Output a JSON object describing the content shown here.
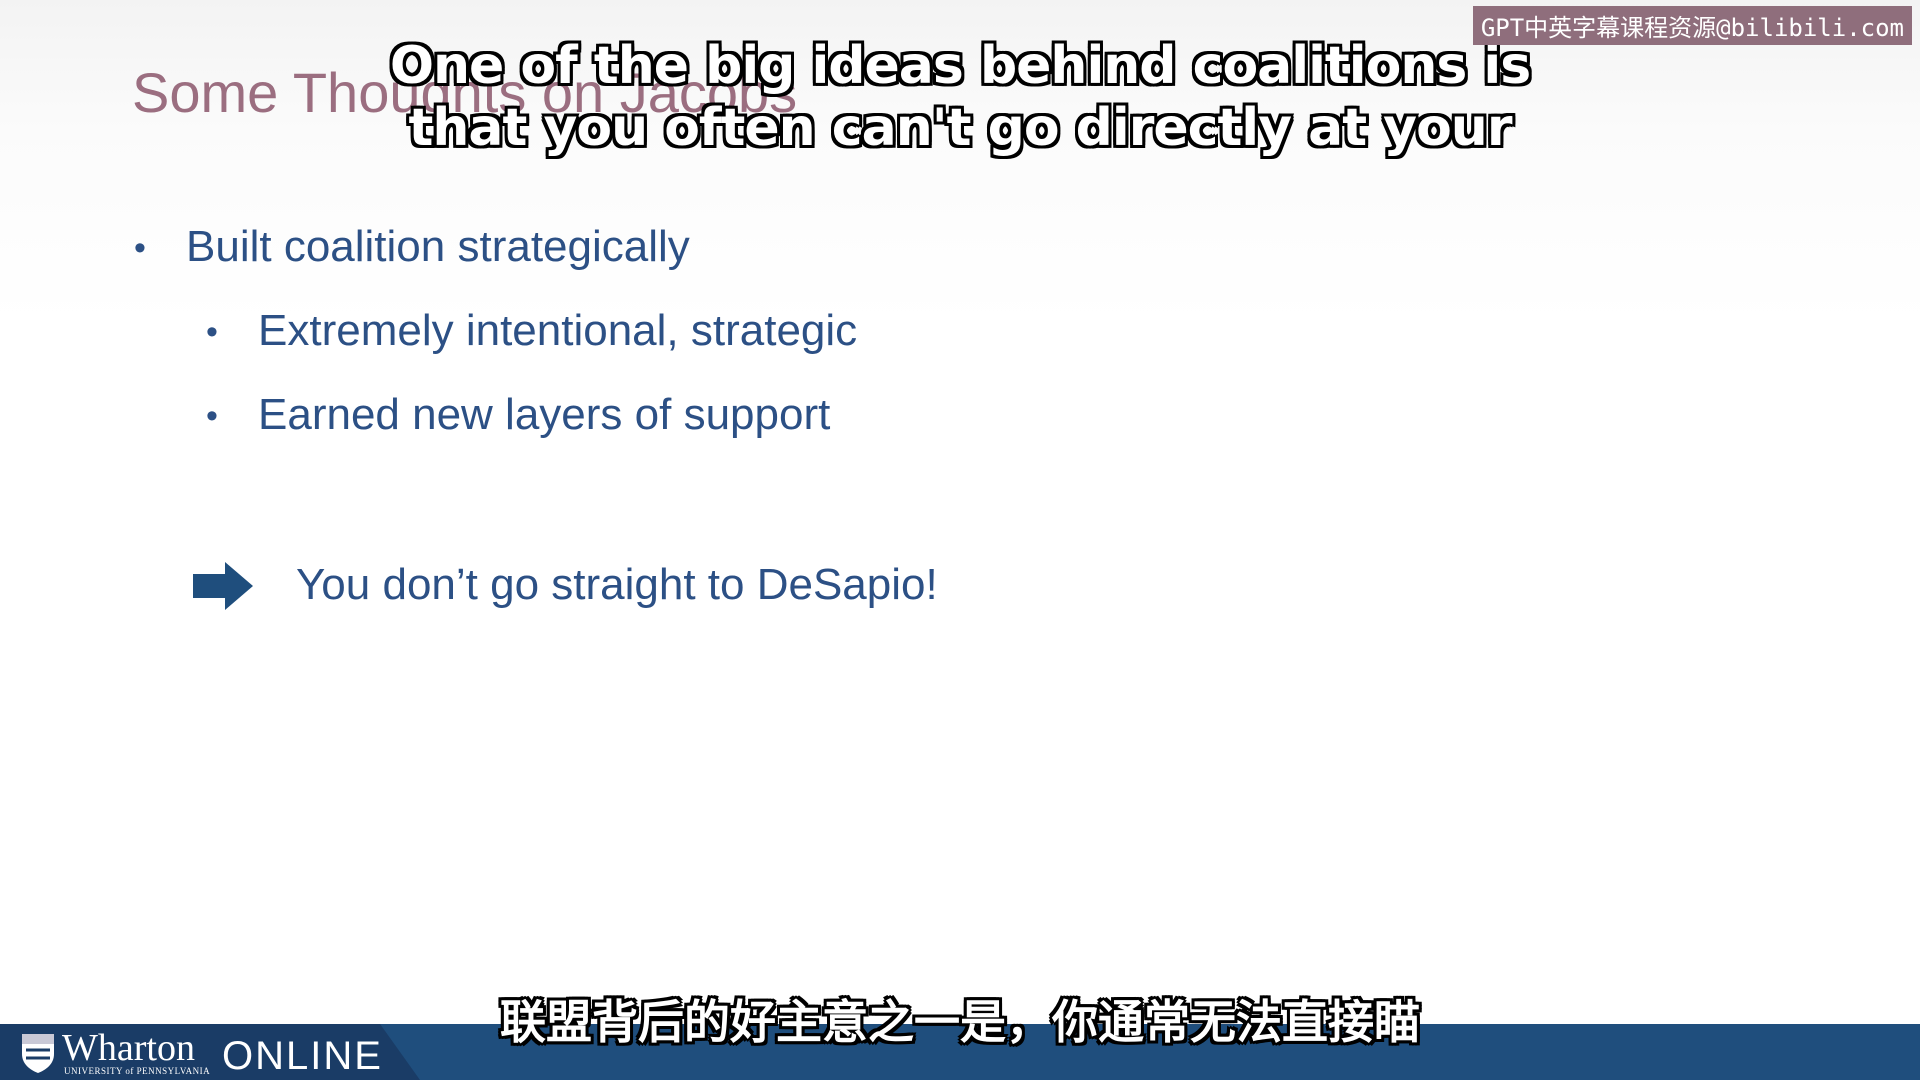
{
  "slide": {
    "title": "Some Thoughts on Jacobs",
    "bullets": [
      {
        "text": "Built coalition strategically",
        "level": 1
      },
      {
        "text": "Extremely intentional, strategic",
        "level": 2
      },
      {
        "text": "Earned new layers of support",
        "level": 2
      }
    ],
    "conclusion": "You don’t go straight to DeSapio!",
    "bullet_char": "•"
  },
  "subtitles": {
    "en_line1": "One of the big ideas behind coalitions is",
    "en_line2": "that you often can't go directly at your",
    "cn": "联盟背后的好主意之一是，你通常无法直接瞄"
  },
  "watermark": "GPT中英字幕课程资源@bilibili.com",
  "footer": {
    "brand": "Wharton",
    "university": "UNIVERSITY of PENNSYLVANIA",
    "online": "ONLINE"
  },
  "colors": {
    "title": "#9b6e80",
    "body_text": "#2c5085",
    "footer_bar": "#1f4e7d",
    "watermark_bg": "#8f6e7c"
  },
  "icons": [
    "right-arrow-icon",
    "penn-shield-icon"
  ]
}
